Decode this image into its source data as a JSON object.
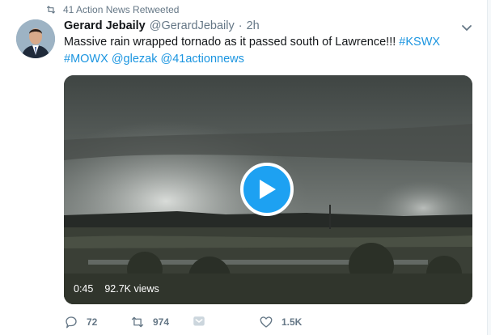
{
  "retweet_context": {
    "text": "41 Action News Retweeted",
    "icon": "retweet-icon"
  },
  "tweet": {
    "display_name": "Gerard Jebaily",
    "handle": "@GerardJebaily",
    "separator": "·",
    "time": "2h",
    "text_plain": "Massive rain wrapped tornado as it passed south of Lawrence!!! ",
    "hashtag1": "#KSWX",
    "hashtag2": "#MOWX",
    "mention1": "@glezak",
    "mention2": "@41actionnews"
  },
  "media": {
    "duration": "0:45",
    "views": "92.7K views",
    "accent": "#1da1f2"
  },
  "actions": {
    "reply_count": "72",
    "retweet_count": "974",
    "like_count": "1.5K"
  },
  "colors": {
    "link": "#1b95e0",
    "muted": "#657786"
  }
}
